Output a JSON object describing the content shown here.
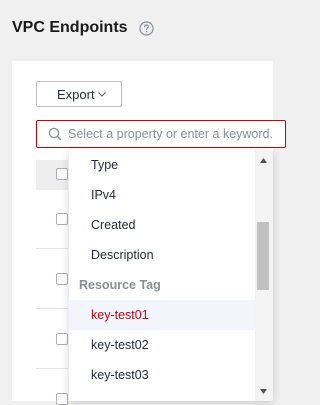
{
  "page": {
    "title": "VPC Endpoints"
  },
  "icons": {
    "help": "help-circle-icon",
    "search": "search-icon",
    "export_caret": "chevron-down-icon",
    "scroll_up": "scroll-up-arrow-icon",
    "scroll_down": "scroll-down-arrow-icon"
  },
  "toolbar": {
    "export_label": "Export"
  },
  "search": {
    "placeholder": "Select a property or enter a keyword."
  },
  "dropdown": {
    "items": [
      {
        "label": "Type"
      },
      {
        "label": "IPv4"
      },
      {
        "label": "Created"
      },
      {
        "label": "Description"
      },
      {
        "label": "Resource Tag",
        "group": true
      },
      {
        "label": "key-test01",
        "selected": true
      },
      {
        "label": "key-test02"
      },
      {
        "label": "key-test03"
      }
    ]
  },
  "colors": {
    "accent": "#c7000b",
    "group_header": "#8a8e99",
    "selected_bg": "#f2f5fc"
  }
}
